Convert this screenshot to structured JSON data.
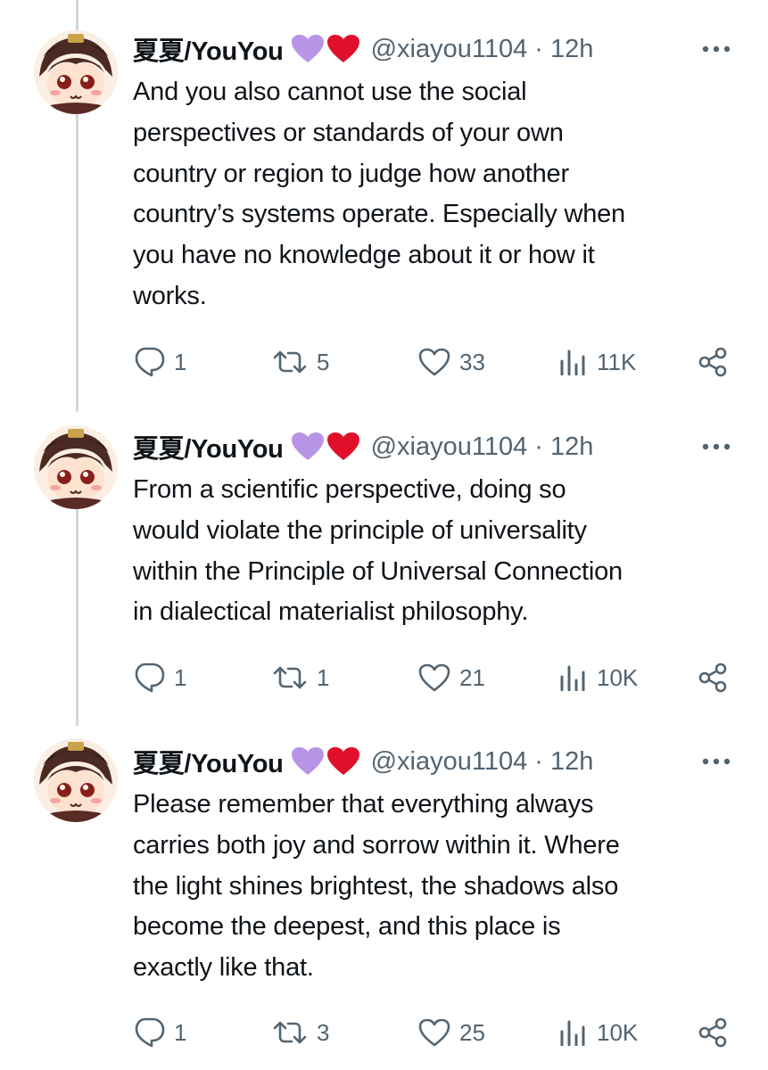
{
  "tweets": [
    {
      "display_name": "夏夏/YouYou",
      "handle": "@xiayou1104",
      "time": "12h",
      "handle_time": "@xiayou1104 · 12h",
      "text": "And you also cannot use the social\nperspectives or standards of your own\ncountry or region to judge how another\ncountry’s systems operate. Especially when\nyou have no knowledge about it or how it\nworks.",
      "replies": "1",
      "retweets": "5",
      "likes": "33",
      "views": "11K"
    },
    {
      "display_name": "夏夏/YouYou",
      "handle": "@xiayou1104",
      "time": "12h",
      "handle_time": "@xiayou1104 · 12h",
      "text": "From a scientific perspective, doing so\nwould violate the principle of universality\nwithin the Principle of Universal Connection\nin dialectical materialist philosophy.",
      "replies": "1",
      "retweets": "1",
      "likes": "21",
      "views": "10K"
    },
    {
      "display_name": "夏夏/YouYou",
      "handle": "@xiayou1104",
      "time": "12h",
      "handle_time": "@xiayou1104 · 12h",
      "text": "Please remember that everything always\ncarries both joy and sorrow within it. Where\nthe light shines brightest, the shadows also\nbecome the deepest, and this place is\nexactly like that.",
      "replies": "1",
      "retweets": "3",
      "likes": "25",
      "views": "10K"
    }
  ],
  "colors": {
    "text": "#0f1419",
    "secondary": "#536471",
    "thread_line": "#cfd9de",
    "purple_heart": "#b794e6",
    "red_heart": "#e0102a"
  },
  "icons": [
    "reply-icon",
    "retweet-icon",
    "like-icon",
    "views-icon",
    "share-icon",
    "more-icon",
    "purple-heart-icon",
    "red-heart-icon"
  ]
}
